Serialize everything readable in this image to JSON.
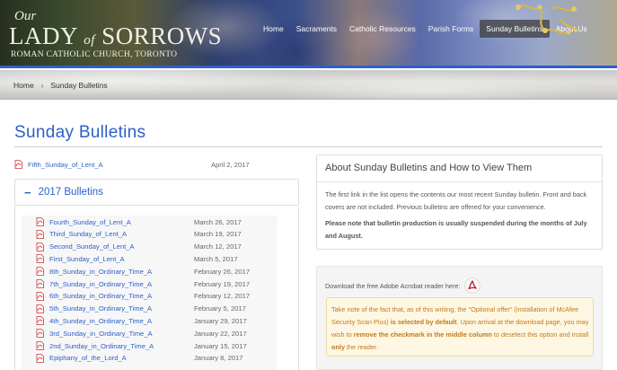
{
  "header": {
    "logo": {
      "our": "Our",
      "lady": "LADY",
      "of": "of",
      "sorrows": "SORROWS",
      "subtitle": "ROMAN CATHOLIC CHURCH, TORONTO"
    },
    "nav": [
      "Home",
      "Sacraments",
      "Catholic Resources",
      "Parish Forms",
      "Sunday Bulletins",
      "About Us"
    ],
    "active_nav": "Sunday Bulletins"
  },
  "breadcrumb": {
    "home": "Home",
    "separator": "›",
    "current": "Sunday Bulletins"
  },
  "page_title": "Sunday Bulletins",
  "latest": {
    "link": "Fifth_Sunday_of_Lent_A",
    "date": "April 2, 2017",
    "icon": "pdf-icon"
  },
  "accordion": {
    "toggle": "−",
    "title": "2017 Bulletins",
    "items": [
      {
        "link": "Fourth_Sunday_of_Lent_A",
        "date": "March 26, 2017"
      },
      {
        "link": "Third_Sunday_of_Lent_A",
        "date": "March 19, 2017"
      },
      {
        "link": "Second_Sunday_of_Lent_A",
        "date": "March 12, 2017"
      },
      {
        "link": "First_Sunday_of_Lent_A",
        "date": "March 5, 2017"
      },
      {
        "link": "8th_Sunday_in_Ordinary_Time_A",
        "date": "February 26, 2017"
      },
      {
        "link": "7th_Sunday_in_Ordinary_Time_A",
        "date": "February 19, 2017"
      },
      {
        "link": "6th_Sunday_in_Ordinary_Time_A",
        "date": "February 12, 2017"
      },
      {
        "link": "5th_Sunday_in_Ordinary_Time_A",
        "date": "February 5, 2017"
      },
      {
        "link": "4th_Sunday_in_Ordinary_Time_A",
        "date": "January 29, 2017"
      },
      {
        "link": "3rd_Sunday_in_Ordinary_Time_A",
        "date": "January 22, 2017"
      },
      {
        "link": "2nd_Sunday_in_Ordinary_Time_A",
        "date": "January 15, 2017"
      },
      {
        "link": "Epiphany_of_the_Lord_A",
        "date": "January 8, 2017"
      }
    ]
  },
  "about": {
    "title": "About Sunday Bulletins and How to View Them",
    "p1": "The first link in the list opens the contents our most recent Sunday bulletin. Front and back covers are not included. Previous bulletins are offered for your convenience.",
    "p2": "Please note that bulletin production is usually suspended during the months of July and August."
  },
  "download": {
    "text": "Download the free Adobe Acrobat reader here:",
    "icon": "acrobat-icon",
    "warning": {
      "part1": "Take note of the fact that, as of this writing, the \"Optional offer\" (installation of McAfee Security Scan Plus) ",
      "bold1": "is selected by default",
      "part2": ". Upon arrival at the download page, you may wish to ",
      "bold2": "remove the checkmark in the middle column",
      "part3": " to deselect this option and install ",
      "bold3": "only",
      "part4": " the reader."
    }
  },
  "colors": {
    "accent": "#2d5fc8",
    "header_stripe": "#2e5fd1",
    "warning_text": "#c47a1a",
    "warning_bg": "#fdf7e3"
  }
}
